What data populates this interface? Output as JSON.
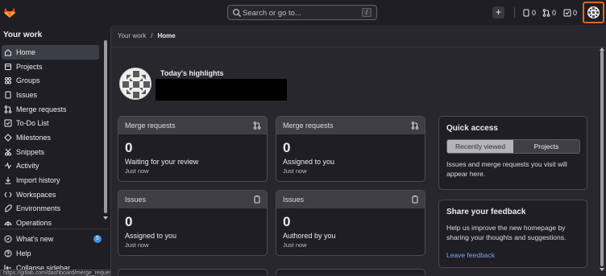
{
  "topbar": {
    "search_placeholder": "Search or go to...",
    "search_shortcut": "/",
    "create_button": "+",
    "issues_count": "0",
    "merge_requests_count": "0",
    "todos_count": "0"
  },
  "sidebar": {
    "title": "Your work",
    "items": [
      {
        "label": "Home",
        "icon": "home-icon",
        "active": true
      },
      {
        "label": "Projects",
        "icon": "project-icon"
      },
      {
        "label": "Groups",
        "icon": "group-icon"
      },
      {
        "label": "Issues",
        "icon": "issues-icon"
      },
      {
        "label": "Merge requests",
        "icon": "merge-request-icon"
      },
      {
        "label": "To-Do List",
        "icon": "todo-icon"
      },
      {
        "label": "Milestones",
        "icon": "milestone-icon"
      },
      {
        "label": "Snippets",
        "icon": "snippet-icon"
      },
      {
        "label": "Activity",
        "icon": "activity-icon"
      },
      {
        "label": "Import history",
        "icon": "import-icon"
      },
      {
        "label": "Workspaces",
        "icon": "workspace-icon"
      },
      {
        "label": "Environments",
        "icon": "environment-icon"
      },
      {
        "label": "Operations",
        "icon": "operations-icon"
      }
    ],
    "bottom": {
      "whats_new": "What's new",
      "whats_new_badge": "5",
      "help": "Help",
      "collapse": "Collapse sidebar"
    },
    "status_url": "https://gitlab.com/dashboard/merge_requests"
  },
  "breadcrumb": {
    "root": "Your work",
    "separator": "/",
    "current": "Home"
  },
  "highlights": {
    "title": "Today's highlights"
  },
  "cards": [
    {
      "title": "Merge requests",
      "icon": "merge-request-icon",
      "count": "0",
      "label": "Waiting for your review",
      "sub": "Just now"
    },
    {
      "title": "Merge requests",
      "icon": "merge-request-icon",
      "count": "0",
      "label": "Assigned to you",
      "sub": "Just now"
    },
    {
      "title": "Issues",
      "icon": "issues-icon",
      "count": "0",
      "label": "Assigned to you",
      "sub": "Just now"
    },
    {
      "title": "Issues",
      "icon": "issues-icon",
      "count": "0",
      "label": "Authored by you",
      "sub": "Just now"
    }
  ],
  "quick_access": {
    "title": "Quick access",
    "tab_recent": "Recently viewed",
    "tab_projects": "Projects",
    "text": "Issues and merge requests you visit will appear here."
  },
  "feedback": {
    "title": "Share your feedback",
    "text": "Help us improve the new homepage by sharing your thoughts and suggestions.",
    "link": "Leave feedback"
  },
  "colors": {
    "accent": "#e2661d",
    "link": "#7ea5e8",
    "badge": "#428fdc"
  }
}
